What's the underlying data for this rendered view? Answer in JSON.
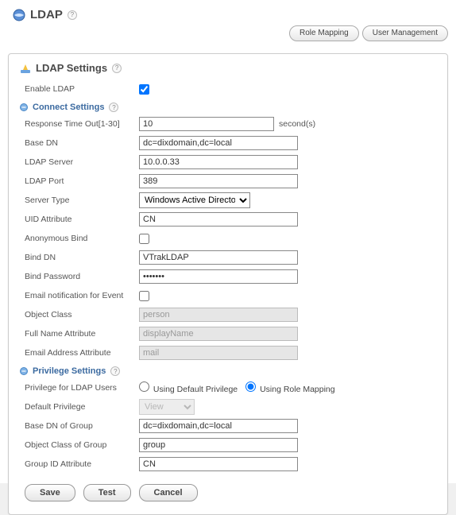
{
  "page": {
    "title": "LDAP"
  },
  "top_buttons": {
    "role_mapping": "Role Mapping",
    "user_management": "User Management"
  },
  "panel": {
    "title": "LDAP Settings"
  },
  "enable": {
    "label": "Enable LDAP",
    "checked": true
  },
  "sections": {
    "connect": {
      "title": "Connect Settings"
    },
    "privilege": {
      "title": "Privilege Settings"
    }
  },
  "fields": {
    "response_timeout": {
      "label": "Response Time Out[1-30]",
      "value": "10",
      "suffix": "second(s)"
    },
    "base_dn": {
      "label": "Base DN",
      "value": "dc=dixdomain,dc=local"
    },
    "ldap_server": {
      "label": "LDAP Server",
      "value": "10.0.0.33"
    },
    "ldap_port": {
      "label": "LDAP Port",
      "value": "389"
    },
    "server_type": {
      "label": "Server Type",
      "value": "Windows Active Directory"
    },
    "uid_attribute": {
      "label": "UID Attribute",
      "value": "CN"
    },
    "anonymous_bind": {
      "label": "Anonymous Bind",
      "checked": false
    },
    "bind_dn": {
      "label": "Bind DN",
      "value": "VTrakLDAP"
    },
    "bind_password": {
      "label": "Bind Password",
      "value": "•••••••"
    },
    "email_notify": {
      "label": "Email notification for Event",
      "checked": false
    },
    "object_class": {
      "label": "Object Class",
      "value": "person"
    },
    "full_name_attr": {
      "label": "Full Name Attribute",
      "value": "displayName"
    },
    "email_attr": {
      "label": "Email Address Attribute",
      "value": "mail"
    },
    "priv_users": {
      "label": "Privilege for LDAP Users",
      "option1": "Using Default Privilege",
      "option2": "Using Role Mapping",
      "selected": "option2"
    },
    "default_priv": {
      "label": "Default Privilege",
      "value": "View"
    },
    "base_dn_group": {
      "label": "Base DN of Group",
      "value": "dc=dixdomain,dc=local"
    },
    "obj_class_group": {
      "label": "Object Class of Group",
      "value": "group"
    },
    "group_id_attr": {
      "label": "Group ID Attribute",
      "value": "CN"
    }
  },
  "buttons": {
    "save": "Save",
    "test": "Test",
    "cancel": "Cancel"
  }
}
